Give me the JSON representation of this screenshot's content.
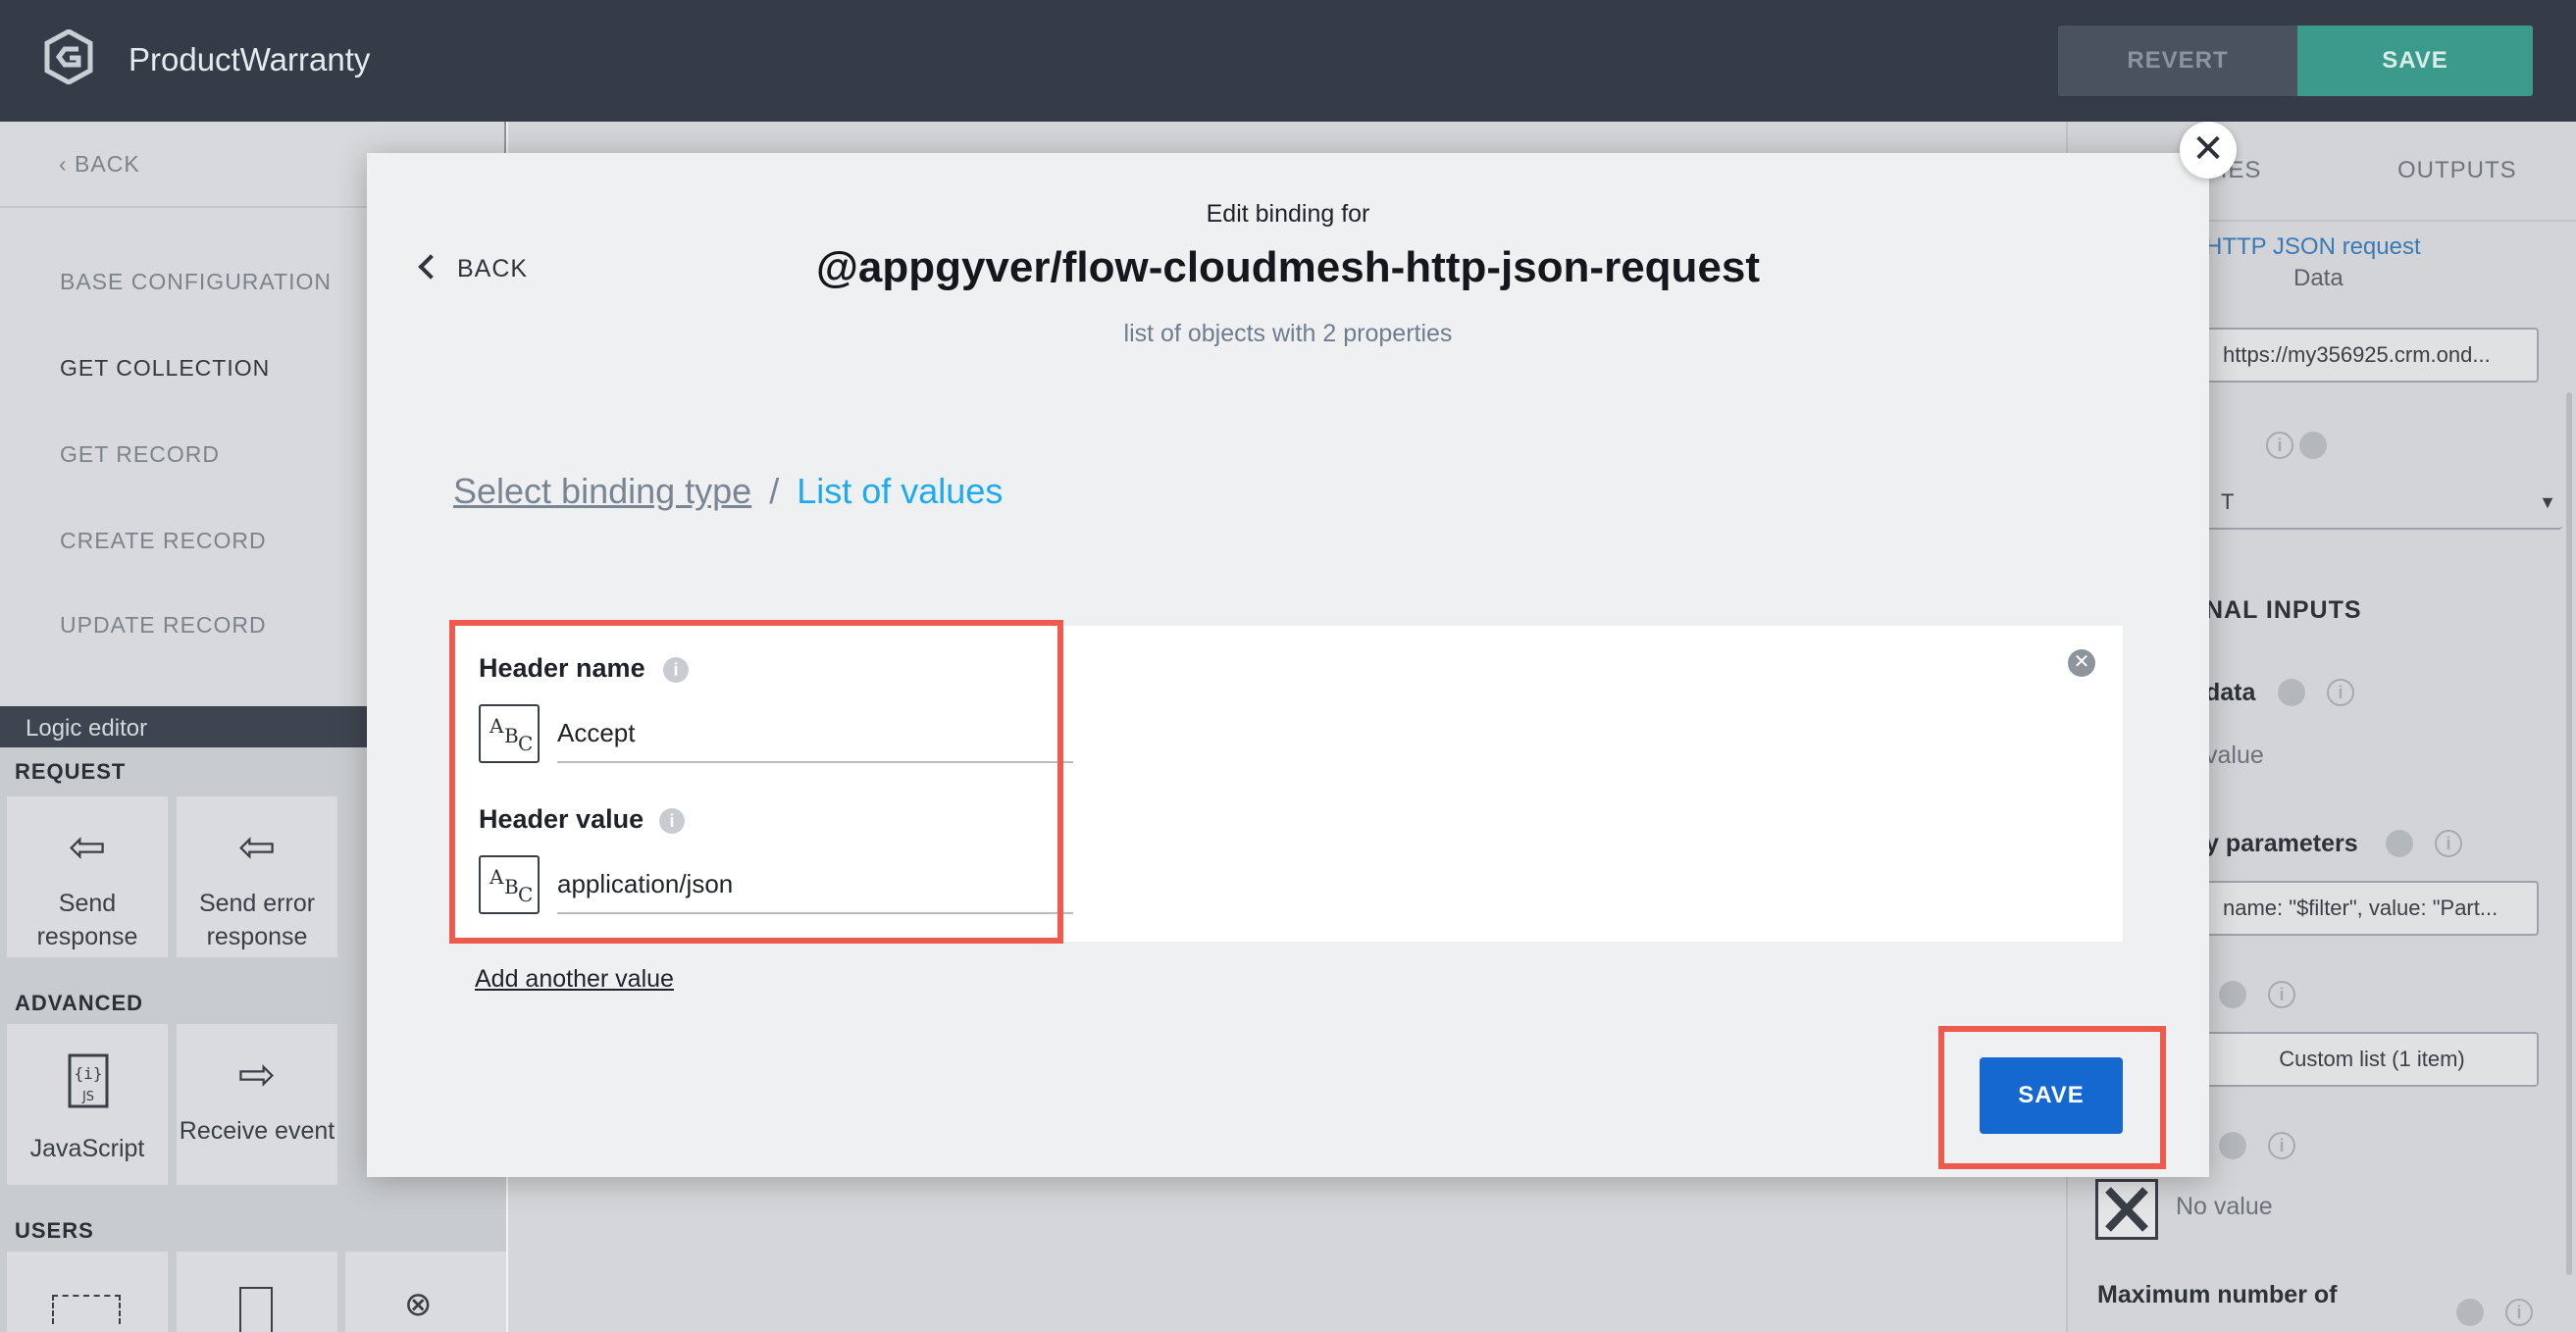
{
  "app": {
    "title": "ProductWarranty"
  },
  "toolbar": {
    "revert_label": "REVERT",
    "save_label": "SAVE"
  },
  "sidebar": {
    "back_label": "‹ BACK",
    "items": [
      {
        "label": "BASE CONFIGURATION"
      },
      {
        "label": "GET COLLECTION"
      },
      {
        "label": "GET RECORD"
      },
      {
        "label": "CREATE RECORD"
      },
      {
        "label": "UPDATE RECORD"
      }
    ]
  },
  "logic_editor": {
    "title": "Logic editor",
    "sections": {
      "request": "REQUEST",
      "advanced": "ADVANCED",
      "users": "USERS"
    },
    "tiles": {
      "send_response": "Send response",
      "send_error_response": "Send error response",
      "javascript": "JavaScript",
      "receive_event": "Receive event"
    }
  },
  "right_panel": {
    "tabs": {
      "properties": "TIES",
      "outputs": "OUTPUTS"
    },
    "flow_link": "HTTP JSON request",
    "flow_sub": "Data",
    "url_value": "https://my356925.crm.ond...",
    "method_value": "T",
    "section_title": "NAL INPUTS",
    "data_label": "data",
    "data_value": "value",
    "query_params_label": "y parameters",
    "query_params_value": "name: \"$filter\", value: \"Part...",
    "custom_list_value": "Custom list (1 item)",
    "no_value": "No value",
    "max_label": "Maximum number of"
  },
  "modal": {
    "back_label": "BACK",
    "edit_label": "Edit binding for",
    "title": "@appgyver/flow-cloudmesh-http-json-request",
    "subtitle": "list of objects with 2 properties",
    "breadcrumb": {
      "select_binding": "Select binding type",
      "separator": "/",
      "current": "List of values"
    },
    "fields": {
      "header_name": {
        "label": "Header name",
        "value": "Accept"
      },
      "header_value": {
        "label": "Header value",
        "value": "application/json"
      }
    },
    "add_another_label": "Add another value",
    "save_label": "SAVE",
    "close_glyph": "✕"
  }
}
